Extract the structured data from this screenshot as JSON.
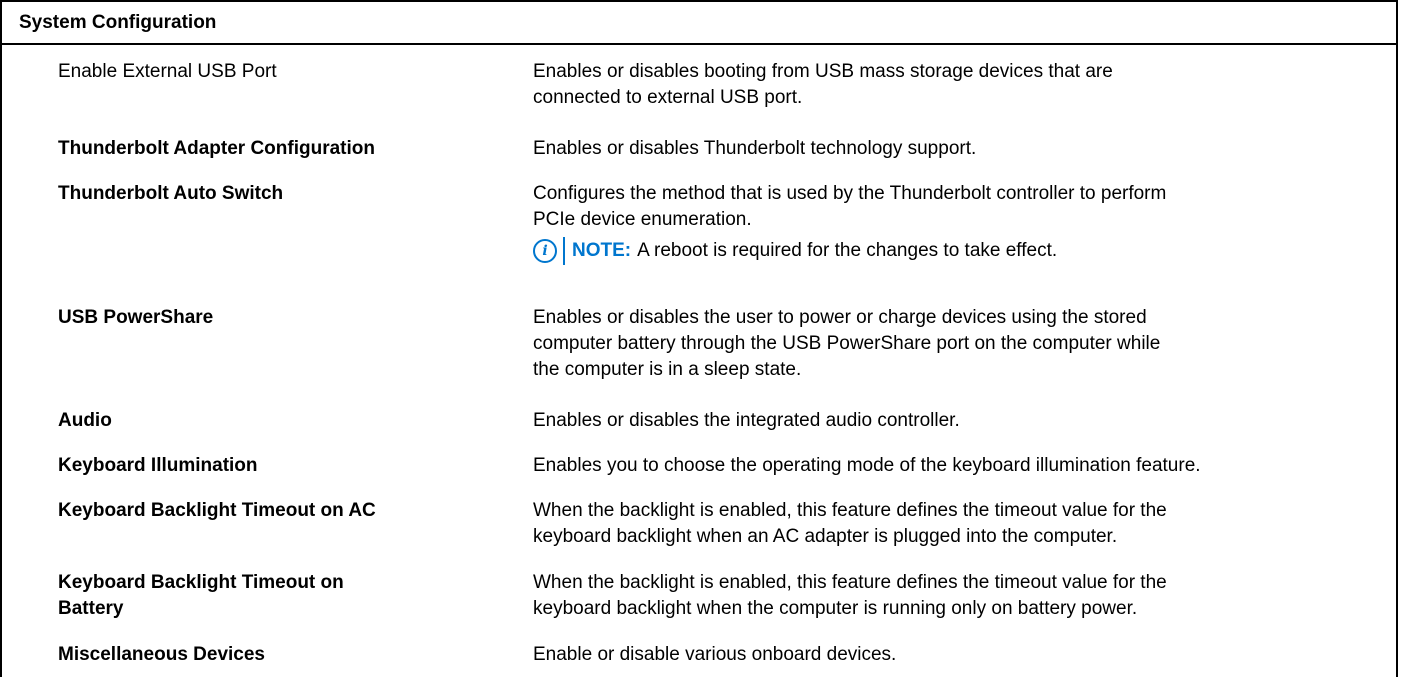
{
  "section": {
    "title": "System Configuration"
  },
  "rows": [
    {
      "name": "Enable External USB Port",
      "desc_lines": [
        "Enables or disables booting from USB mass storage devices that are",
        "connected to external USB port."
      ]
    },
    {
      "name": "Thunderbolt Adapter Configuration",
      "desc_lines": [
        "Enables or disables Thunderbolt technology support."
      ]
    },
    {
      "name": "Thunderbolt Auto Switch",
      "desc_lines": [
        "Configures the method that is used by the Thunderbolt controller to perform",
        "PCIe device enumeration."
      ],
      "note_label": "NOTE:",
      "note_text": "A reboot is required for the changes to take effect."
    },
    {
      "name": "USB PowerShare",
      "desc_lines": [
        "Enables or disables the user to power or charge devices using the stored",
        "computer battery through the USB PowerShare port on the computer while",
        "the computer is in a sleep state."
      ]
    },
    {
      "name": "Audio",
      "desc_lines": [
        "Enables or disables the integrated audio controller."
      ]
    },
    {
      "name": "Keyboard Illumination",
      "desc_lines": [
        "Enables you to choose the operating mode of the keyboard illumination feature."
      ]
    },
    {
      "name": "Keyboard Backlight Timeout on AC",
      "desc_lines": [
        "When the backlight is enabled, this feature defines the timeout value for the",
        "keyboard backlight when an AC adapter is plugged into the computer."
      ]
    },
    {
      "name_lines": [
        "Keyboard Backlight Timeout on",
        "Battery"
      ],
      "desc_lines": [
        "When the backlight is enabled, this feature defines the timeout value for the",
        "keyboard backlight when the computer is running only on battery power."
      ]
    },
    {
      "name": "Miscellaneous Devices",
      "desc_lines": [
        "Enable or disable various onboard devices."
      ]
    }
  ],
  "note_icon_glyph": "i",
  "colors": {
    "note_accent": "#0076ce"
  }
}
